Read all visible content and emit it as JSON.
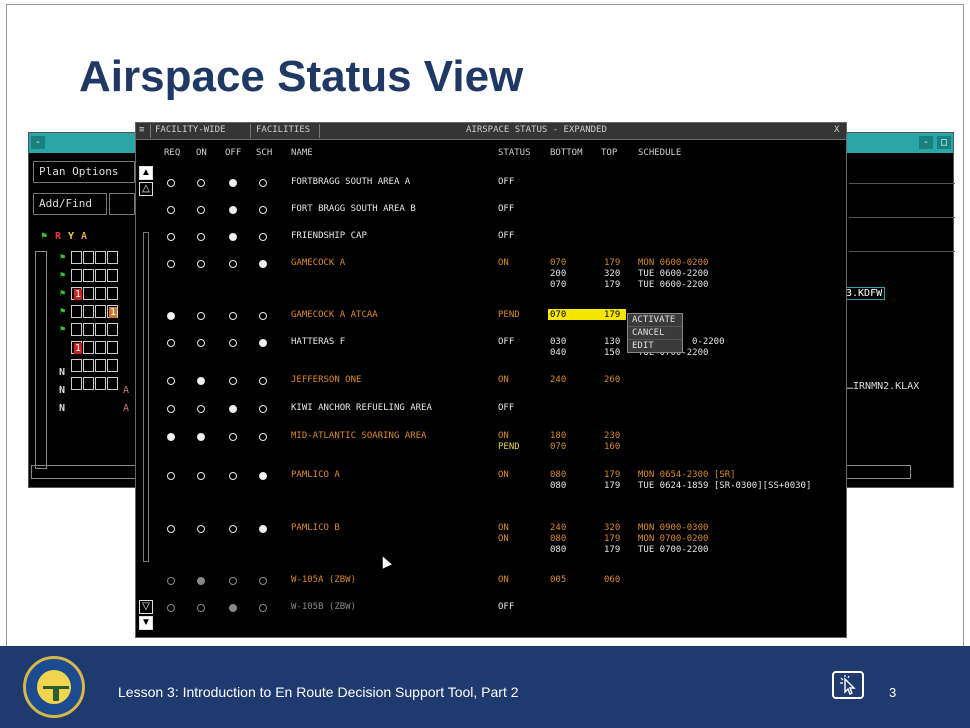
{
  "slide": {
    "title": "Airspace Status View",
    "footer_text": "Lesson 3: Introduction to En Route Decision Support Tool, Part 2",
    "page_number": "3",
    "colors": {
      "title": "#1f3864",
      "footer_bg": "#1e3a6e"
    }
  },
  "background_window": {
    "close_glyph": "-",
    "right_glyphs": [
      "-",
      "□"
    ],
    "plan_options": "Plan Options",
    "add_find": "Add/Find",
    "legend_letters": [
      "R",
      "Y",
      "A"
    ],
    "row_labels": [
      "N",
      "N",
      "N"
    ],
    "flight_ids": [
      "3.KDFW",
      "…IRNMN2.KLAX"
    ],
    "grid_markers": [
      "1",
      "1",
      "1",
      "A",
      "A"
    ]
  },
  "window": {
    "title_tabs": [
      "FACILITY-WIDE",
      "FACILITIES"
    ],
    "title": "AIRSPACE STATUS - EXPANDED",
    "close_label": "X",
    "columns": [
      "REQ",
      "ON",
      "OFF",
      "SCH",
      "NAME",
      "STATUS",
      "BOTTOM",
      "TOP",
      "SCHEDULE"
    ]
  },
  "context_menu": [
    "ACTIVATE",
    "CANCEL",
    "EDIT"
  ],
  "rows": [
    {
      "radios": [
        0,
        0,
        1,
        0
      ],
      "name": "FORTBRAGG SOUTH AREA A",
      "color": "white",
      "status": [
        "OFF"
      ],
      "bottom": [],
      "top": [],
      "schedule": []
    },
    {
      "radios": [
        0,
        0,
        1,
        0
      ],
      "name": "FORT BRAGG SOUTH AREA B",
      "color": "white",
      "status": [
        "OFF"
      ],
      "bottom": [],
      "top": [],
      "schedule": []
    },
    {
      "radios": [
        0,
        0,
        1,
        0
      ],
      "name": "FRIENDSHIP CAP",
      "color": "white",
      "status": [
        "OFF"
      ],
      "bottom": [],
      "top": [],
      "schedule": []
    },
    {
      "radios": [
        0,
        0,
        0,
        1
      ],
      "name": "GAMECOCK A",
      "color": "orange",
      "status": [
        "ON"
      ],
      "bottom": [
        "070",
        "200",
        "070"
      ],
      "top": [
        "179",
        "320",
        "179"
      ],
      "schedule": [
        "MON 0600-0200",
        "TUE 0600-2200",
        "TUE 0600-2200"
      ],
      "line_colors": [
        "orange",
        "white",
        "white"
      ]
    },
    {
      "radios": [
        1,
        0,
        0,
        0
      ],
      "name": "GAMECOCK A ATCAA",
      "color": "orange",
      "status": [
        "PEND"
      ],
      "bottom": [
        "070"
      ],
      "top": [
        "179"
      ],
      "schedule": [],
      "highlight": true
    },
    {
      "radios": [
        0,
        0,
        0,
        1
      ],
      "name": "HATTERAS F",
      "color": "white",
      "status": [
        "OFF"
      ],
      "bottom": [
        "030",
        "040"
      ],
      "top": [
        "130",
        "150"
      ],
      "schedule": [
        "0-2200",
        "TUE 0700-2200"
      ],
      "line_colors": [
        "white",
        "white"
      ]
    },
    {
      "radios": [
        0,
        1,
        0,
        0
      ],
      "name": "JEFFERSON ONE",
      "color": "orange",
      "status": [
        "ON"
      ],
      "bottom": [
        "240"
      ],
      "top": [
        "260"
      ],
      "schedule": []
    },
    {
      "radios": [
        0,
        0,
        1,
        0
      ],
      "name": "KIWI ANCHOR REFUELING AREA",
      "color": "white",
      "status": [
        "OFF"
      ],
      "bottom": [],
      "top": [],
      "schedule": []
    },
    {
      "radios": [
        1,
        1,
        0,
        0
      ],
      "name": "MID-ATLANTIC SOARING AREA",
      "color": "orange",
      "status": [
        "ON",
        "PEND"
      ],
      "bottom": [
        "180",
        "070"
      ],
      "top": [
        "230",
        "160"
      ],
      "schedule": []
    },
    {
      "radios": [
        0,
        0,
        0,
        1
      ],
      "name": "PAMLICO A",
      "color": "orange",
      "status": [
        "ON"
      ],
      "bottom": [
        "080",
        "080"
      ],
      "top": [
        "179",
        "179"
      ],
      "schedule": [
        "MON 0654-2300 [SR]",
        "TUE 0624-1859 [SR-0300][SS+0030]"
      ],
      "line_colors": [
        "orange",
        "white"
      ]
    },
    {
      "radios": [
        0,
        0,
        0,
        1
      ],
      "name": "PAMLICO B",
      "color": "orange",
      "status": [
        "ON",
        "ON"
      ],
      "bottom": [
        "240",
        "080",
        "080"
      ],
      "top": [
        "320",
        "179",
        "179"
      ],
      "schedule": [
        "MON 0900-0300",
        "MON 0700-0200",
        "TUE 0700-2200"
      ],
      "line_colors": [
        "orange",
        "orange",
        "white"
      ]
    },
    {
      "radios": [
        0,
        1,
        0,
        0
      ],
      "name": "W-105A (ZBW)",
      "color": "orange",
      "status": [
        "ON"
      ],
      "bottom": [
        "005"
      ],
      "top": [
        "060"
      ],
      "schedule": [],
      "dim": true
    },
    {
      "radios": [
        0,
        0,
        1,
        0
      ],
      "name": "W-105B (ZBW)",
      "color": "gray",
      "status": [
        "OFF"
      ],
      "bottom": [],
      "top": [],
      "schedule": [],
      "dim": true
    }
  ]
}
